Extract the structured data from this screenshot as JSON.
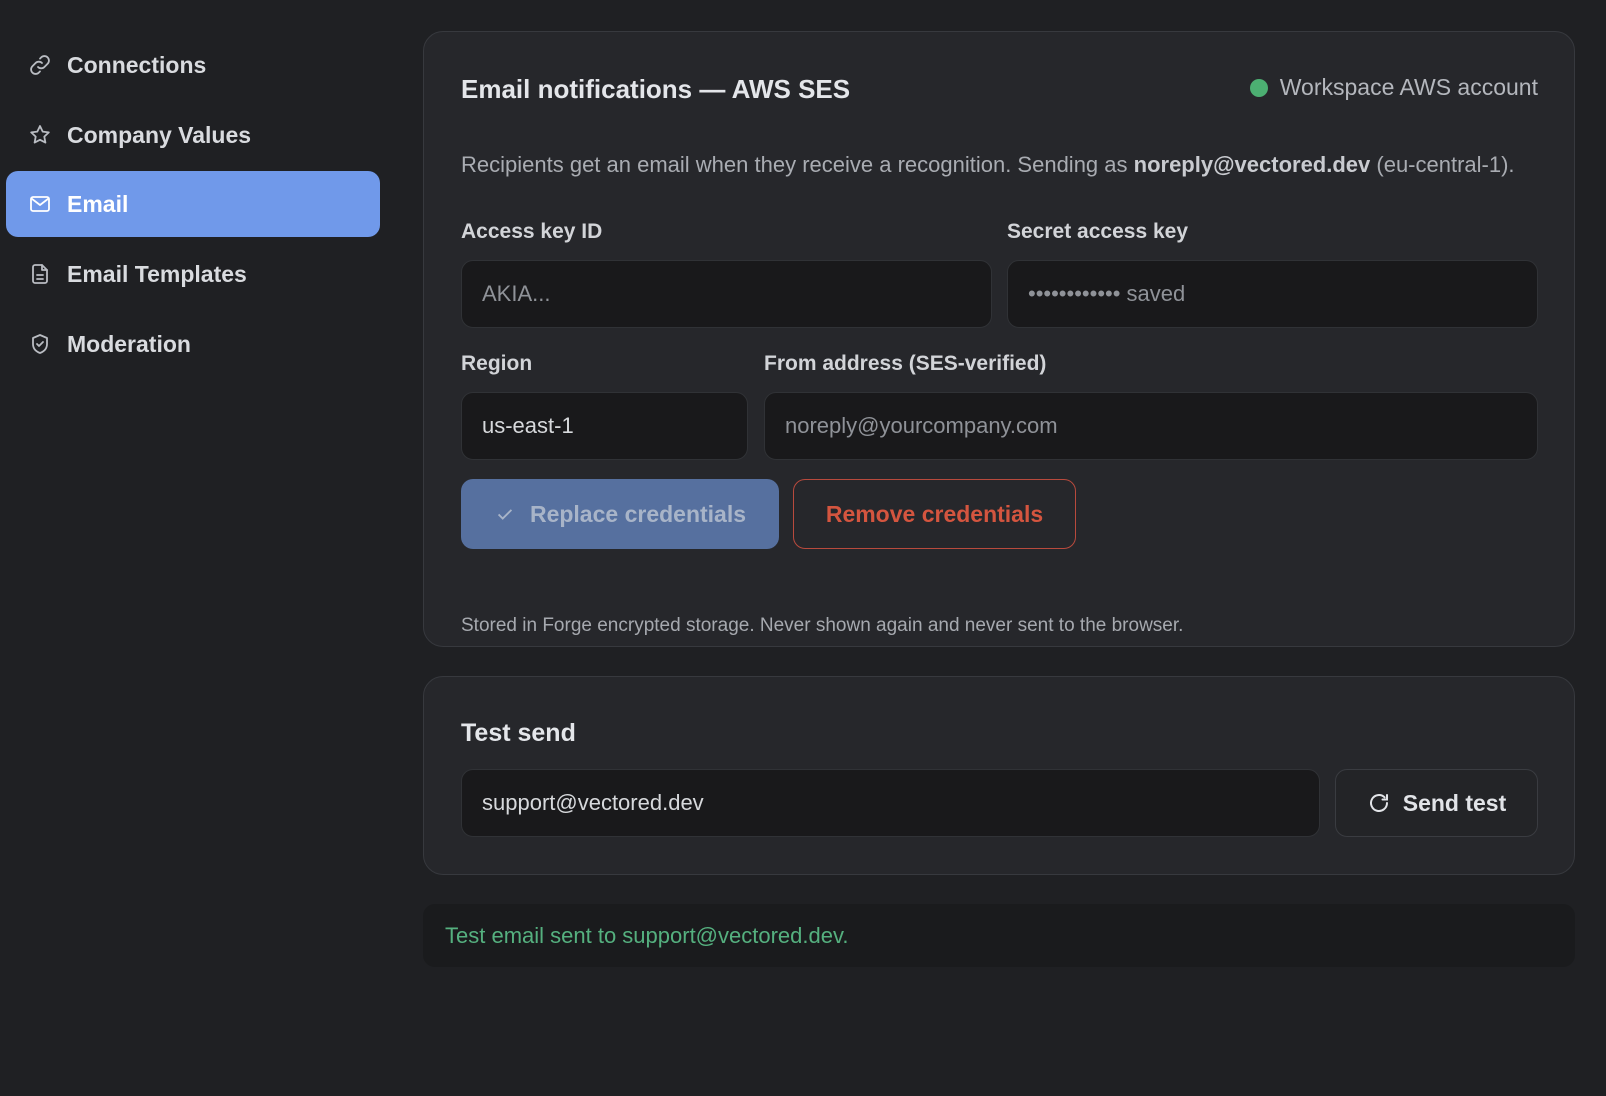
{
  "sidebar": {
    "items": [
      {
        "label": "Connections",
        "icon": "link-icon",
        "active": false
      },
      {
        "label": "Company Values",
        "icon": "star-icon",
        "active": false
      },
      {
        "label": "Email",
        "icon": "mail-icon",
        "active": true
      },
      {
        "label": "Email Templates",
        "icon": "document-icon",
        "active": false
      },
      {
        "label": "Moderation",
        "icon": "shield-icon",
        "active": false
      }
    ]
  },
  "ses_card": {
    "title": "Email notifications — AWS SES",
    "status_label": "Workspace AWS account",
    "status_color": "#4caf72",
    "description_prefix": "Recipients get an email when they receive a recognition. Sending as ",
    "description_email": "noreply@vectored.dev",
    "description_suffix": " (eu-central-1).",
    "access_key_label": "Access key ID",
    "access_key_placeholder": "AKIA...",
    "secret_key_label": "Secret access key",
    "secret_key_value": "•••••••••••• saved",
    "region_label": "Region",
    "region_value": "us-east-1",
    "from_label": "From address (SES-verified)",
    "from_placeholder": "noreply@yourcompany.com",
    "replace_button": "Replace credentials",
    "remove_button": "Remove credentials",
    "note": "Stored in Forge encrypted storage. Never shown again and never sent to the browser."
  },
  "test_card": {
    "title": "Test send",
    "email_value": "support@vectored.dev",
    "send_button": "Send test"
  },
  "toast": {
    "message": "Test email sent to support@vectored.dev."
  }
}
